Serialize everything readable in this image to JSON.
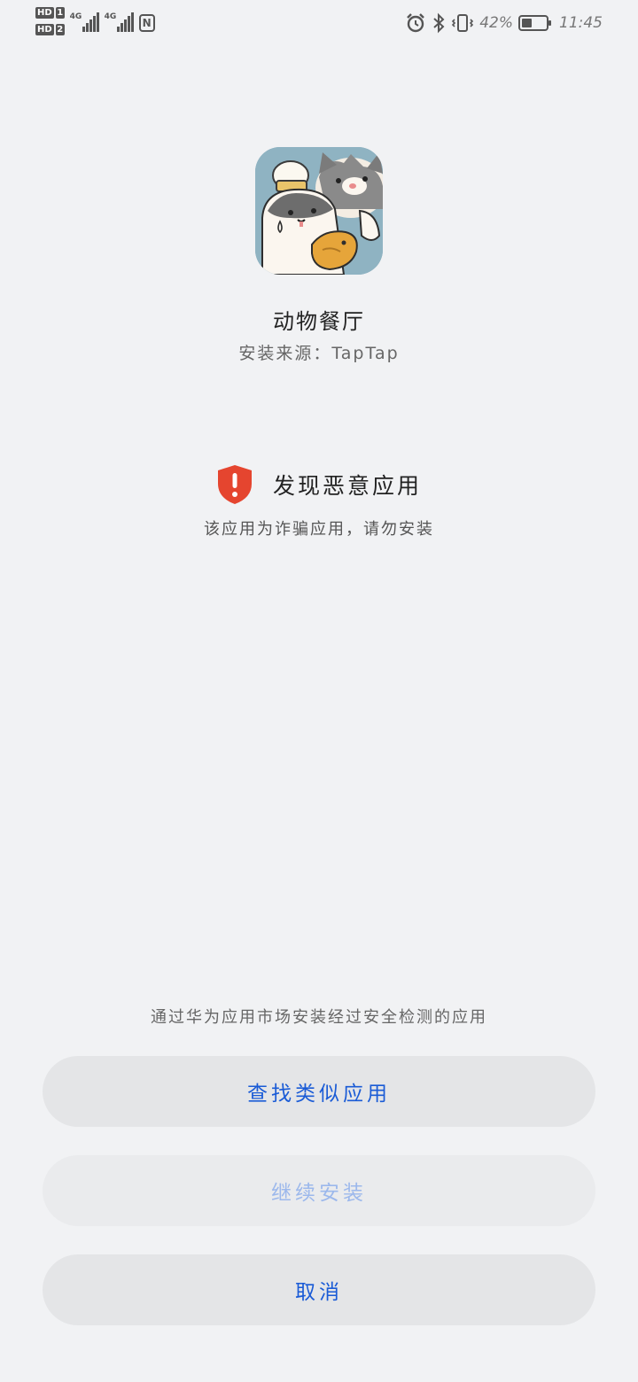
{
  "status_bar": {
    "sim1_label": "HD",
    "sim1_num": "1",
    "sim2_label": "HD",
    "sim2_num": "2",
    "signal1_tag": "4G",
    "signal2_tag": "4G",
    "nfc_label": "N",
    "battery_percent_text": "42%",
    "battery_level": 0.42,
    "time": "11:45",
    "icons": [
      "alarm-icon",
      "bluetooth-icon",
      "vibrate-icon"
    ]
  },
  "app": {
    "name": "动物餐厅",
    "source": "安装来源：TapTap"
  },
  "warning": {
    "title": "发现恶意应用",
    "description": "该应用为诈骗应用，请勿安装",
    "color": "#e5452f"
  },
  "footer": {
    "hint": "通过华为应用市场安装经过安全检测的应用",
    "find_similar_label": "查找类似应用",
    "continue_label": "继续安装",
    "cancel_label": "取消"
  },
  "colors": {
    "background": "#f1f2f4",
    "button_bg": "#e4e5e7",
    "accent": "#1a5bd6",
    "disabled_text": "#9cb8ec"
  }
}
